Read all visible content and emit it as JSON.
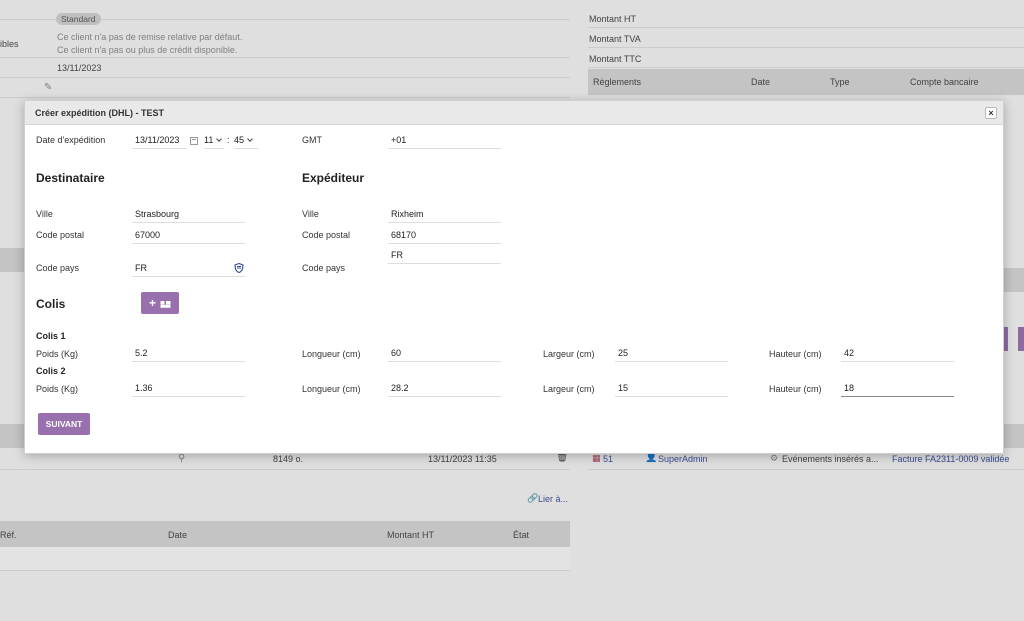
{
  "background": {
    "left": {
      "badge": "Standard",
      "partial_label": "ibles",
      "discount_note": "Ce client n'a pas de remise relative par défaut.",
      "credit_note": "Ce client n'a pas ou plus de crédit disponible.",
      "date": "13/11/2023",
      "file_size": "8149 o.",
      "file_date": "13/11/2023 11:35",
      "link_label": "Lier à...",
      "table_headers": [
        "Réf.",
        "Date",
        "Montant HT",
        "État"
      ]
    },
    "right": {
      "amount_ht": "Montant HT",
      "amount_tva": "Montant TVA",
      "amount_ttc": "Montant TTC",
      "payments_headers": [
        "Règlements",
        "Date",
        "Type",
        "Compte bancaire"
      ],
      "event_id": "51",
      "event_user": "SuperAdmin",
      "event_desc": "Evénements insérés a...",
      "event_link": "Facture FA2311-0009 validée"
    }
  },
  "dialog": {
    "title": "Créer expédition (DHL) - TEST",
    "close_label": "×",
    "ship_date_label": "Date d'expédition",
    "ship_date": "13/11/2023",
    "hour": "11",
    "minute": "45",
    "gmt_label": "GMT",
    "gmt_value": "+01",
    "recipient": {
      "heading": "Destinataire",
      "city_label": "Ville",
      "city": "Strasbourg",
      "postal_label": "Code postal",
      "postal": "67000",
      "country_label": "Code pays",
      "country": "FR"
    },
    "sender": {
      "heading": "Expéditeur",
      "city_label": "Ville",
      "city": "Rixheim",
      "postal_label": "Code postal",
      "postal": "68170",
      "country_label": "Code pays",
      "country": "FR"
    },
    "parcels_heading": "Colis",
    "add_parcel_plus": "+",
    "parcels": [
      {
        "title": "Colis 1",
        "weight_label": "Poids (Kg)",
        "weight": "5.2",
        "length_label": "Longueur (cm)",
        "length": "60",
        "width_label": "Largeur (cm)",
        "width": "25",
        "height_label": "Hauteur (cm)",
        "height": "42"
      },
      {
        "title": "Colis 2",
        "weight_label": "Poids (Kg)",
        "weight": "1.36",
        "length_label": "Longueur (cm)",
        "length": "28.2",
        "width_label": "Largeur (cm)",
        "width": "15",
        "height_label": "Hauteur (cm)",
        "height": "18"
      }
    ],
    "next_label": "SUIVANT"
  },
  "colors": {
    "accent": "#9870ad",
    "link": "#3b4f9e"
  }
}
